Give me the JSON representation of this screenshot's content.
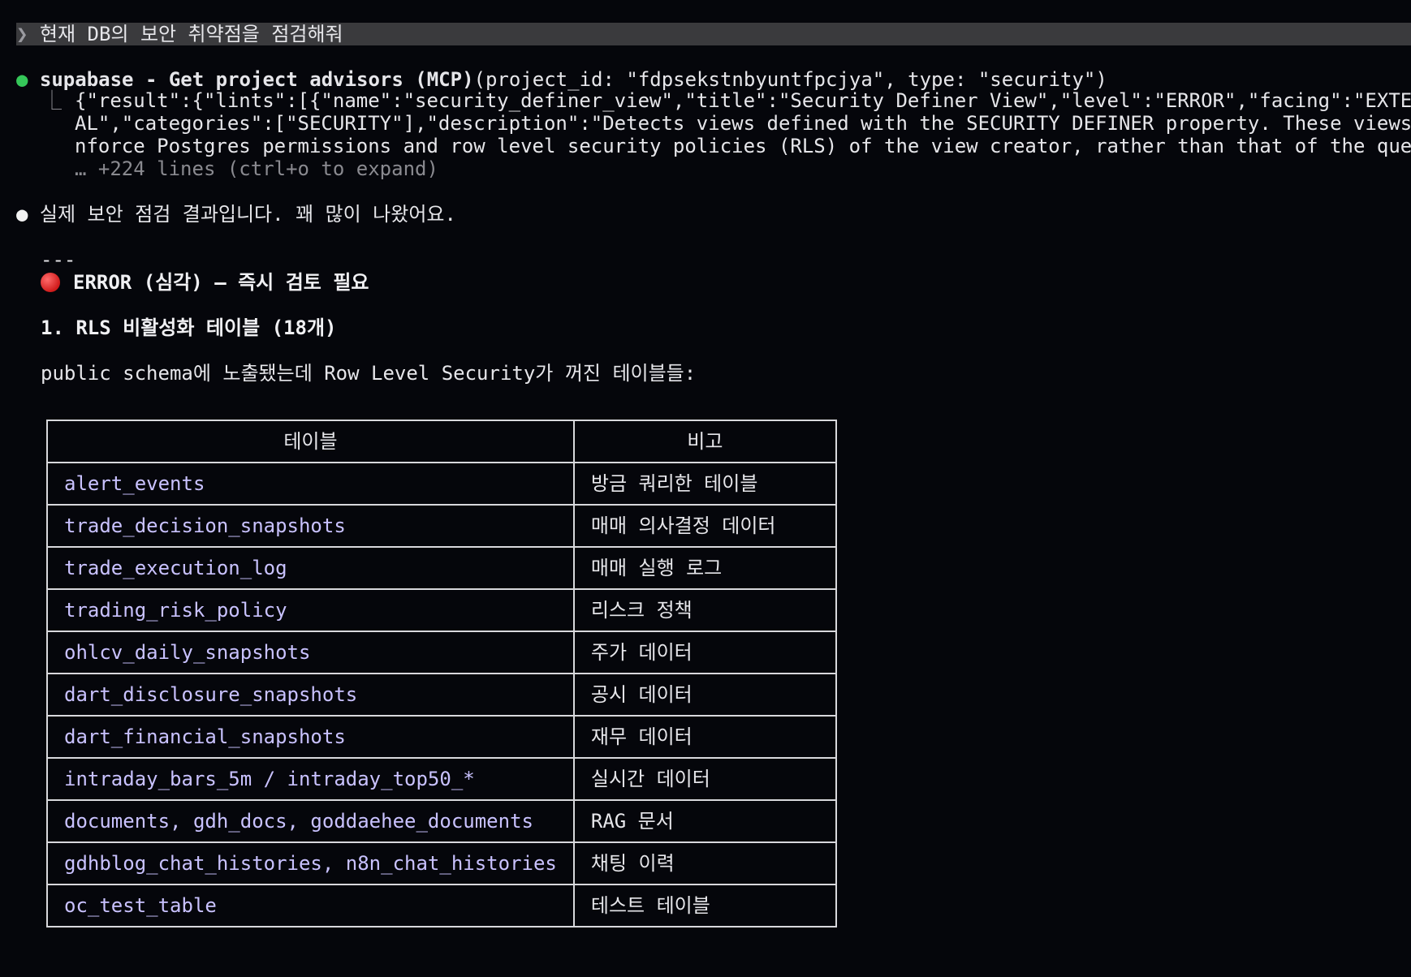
{
  "prompt": {
    "caret": "❯",
    "text": "현재 DB의 보안 취약점을 점검해줘"
  },
  "tool_call": {
    "bullet": "●",
    "name": "supabase - Get project advisors (MCP)",
    "args": "(project_id: \"fdpsekstnbyuntfpcjya\", type: \"security\")",
    "output_prefix": "⎿",
    "output_lines": [
      "{\"result\":{\"lints\":[{\"name\":\"security_definer_view\",\"title\":\"Security Definer View\",\"level\":\"ERROR\",\"facing\":\"EXTERN",
      "AL\",\"categories\":[\"SECURITY\"],\"description\":\"Detects views defined with the SECURITY DEFINER property. These views e",
      "nforce Postgres permissions and row level security policies (RLS) of the view creator, rather than that of the query"
    ],
    "collapsed_note": "… +224 lines (ctrl+o to expand)"
  },
  "response": {
    "bullet": "●",
    "intro": "실제 보안 점검 결과입니다. 꽤 많이 나왔어요.",
    "separator": "---",
    "error_heading": "ERROR (심각) — 즉시 검토 필요",
    "section_title": "1. RLS 비활성화 테이블 (18개)",
    "section_desc": "public schema에 노출됐는데 Row Level Security가 꺼진 테이블들:",
    "table": {
      "headers": [
        "테이블",
        "비고"
      ],
      "rows": [
        [
          "alert_events",
          "방금 쿼리한 테이블"
        ],
        [
          "trade_decision_snapshots",
          "매매 의사결정 데이터"
        ],
        [
          "trade_execution_log",
          "매매 실행 로그"
        ],
        [
          "trading_risk_policy",
          "리스크 정책"
        ],
        [
          "ohlcv_daily_snapshots",
          "주가 데이터"
        ],
        [
          "dart_disclosure_snapshots",
          "공시 데이터"
        ],
        [
          "dart_financial_snapshots",
          "재무 데이터"
        ],
        [
          "intraday_bars_5m / intraday_top50_*",
          "실시간 데이터"
        ],
        [
          "documents, gdh_docs, goddaehee_documents",
          "RAG 문서"
        ],
        [
          "gdhblog_chat_histories, n8n_chat_histories",
          "채팅 이력"
        ],
        [
          "oc_test_table",
          "테스트 테이블"
        ]
      ]
    }
  }
}
